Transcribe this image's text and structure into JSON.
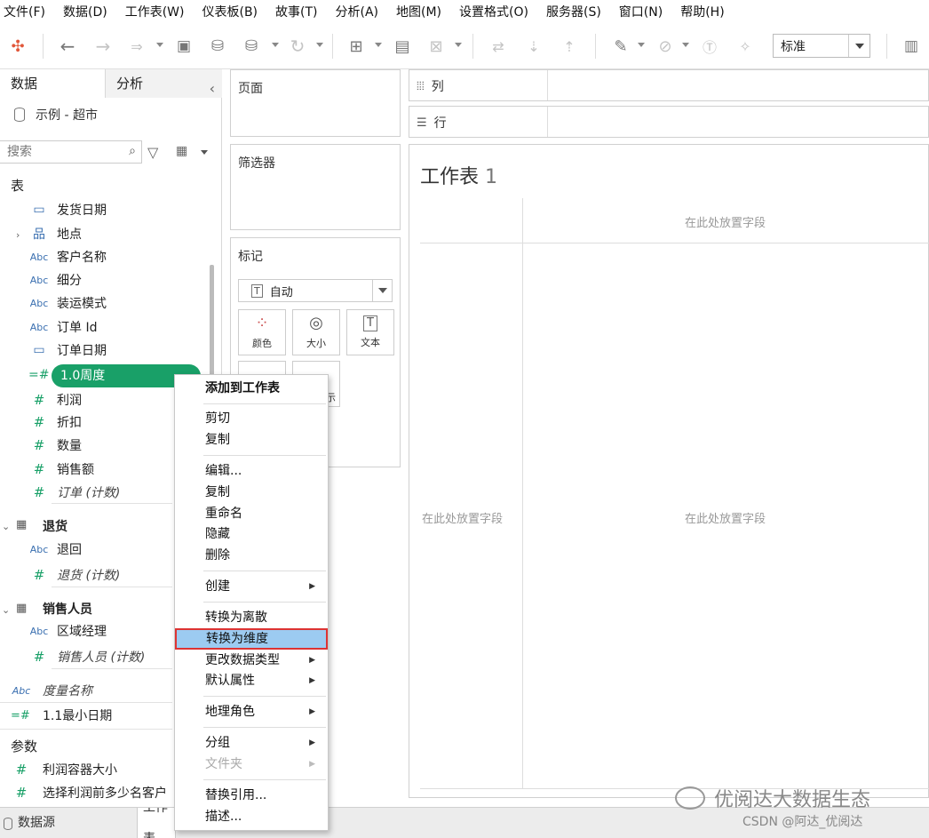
{
  "menubar": [
    "文件(F)",
    "数据(D)",
    "工作表(W)",
    "仪表板(B)",
    "故事(T)",
    "分析(A)",
    "地图(M)",
    "设置格式(O)",
    "服务器(S)",
    "窗口(N)",
    "帮助(H)"
  ],
  "toolbar": {
    "fit_select": "标准"
  },
  "data_pane": {
    "tab_data": "数据",
    "tab_analysis": "分析",
    "datasource": "示例 - 超市",
    "search_placeholder": "搜索",
    "section_tables": "表",
    "orders_fields": [
      {
        "icon": "date",
        "label": "发货日期"
      },
      {
        "icon": "geo",
        "label": "地点"
      },
      {
        "icon": "abc",
        "label": "客户名称"
      },
      {
        "icon": "abc",
        "label": "细分"
      },
      {
        "icon": "abc",
        "label": "装运模式"
      },
      {
        "icon": "abc",
        "label": "订单 Id"
      },
      {
        "icon": "date",
        "label": "订单日期"
      }
    ],
    "selected_field": "1.0周度",
    "measure_fields": [
      "利润",
      "折扣",
      "数量",
      "销售额"
    ],
    "orders_count": "订单 (计数)",
    "returns_table": "退货",
    "returns_field": "退回",
    "returns_count": "退货 (计数)",
    "sales_table": "销售人员",
    "sales_field": "区域经理",
    "sales_count": "销售人员 (计数)",
    "measure_names": "度量名称",
    "min_date": "1.1最小日期",
    "section_params": "参数",
    "params": [
      "利润容器大小",
      "选择利润前多少名客户"
    ],
    "icon_labels": {
      "abc": "Abc",
      "hash": "#",
      "date": "▭",
      "geo": "品"
    }
  },
  "cards": {
    "pages": "页面",
    "filters": "筛选器",
    "marks": "标记",
    "marks_type": "自动",
    "mark_color": "颜色",
    "mark_size": "大小",
    "mark_text": "文本",
    "mark_tooltip_partial": "示"
  },
  "shelves": {
    "columns": "列",
    "rows": "行"
  },
  "sheet": {
    "title": "工作表",
    "title_num": "1",
    "drop_hint": "在此处放置字段"
  },
  "context_menu": {
    "add_to_sheet": "添加到工作表",
    "cut": "剪切",
    "copy": "复制",
    "edit": "编辑...",
    "duplicate": "复制",
    "rename": "重命名",
    "hide": "隐藏",
    "delete": "删除",
    "create": "创建",
    "to_discrete": "转换为离散",
    "to_dimension": "转换为维度",
    "change_type": "更改数据类型",
    "default_props": "默认属性",
    "geo_role": "地理角色",
    "group": "分组",
    "folder": "文件夹",
    "replace_refs": "替换引用...",
    "describe": "描述..."
  },
  "bottom": {
    "datasource_tab": "数据源",
    "sheet_tab": "工作表"
  },
  "watermark": "优阅达大数据生态",
  "credit": "CSDN @阿达_优阅达",
  "colors": {
    "accent_green": "#19a068",
    "menu_highlight": "#9ccbf1",
    "highlight_border": "#dd3333"
  }
}
